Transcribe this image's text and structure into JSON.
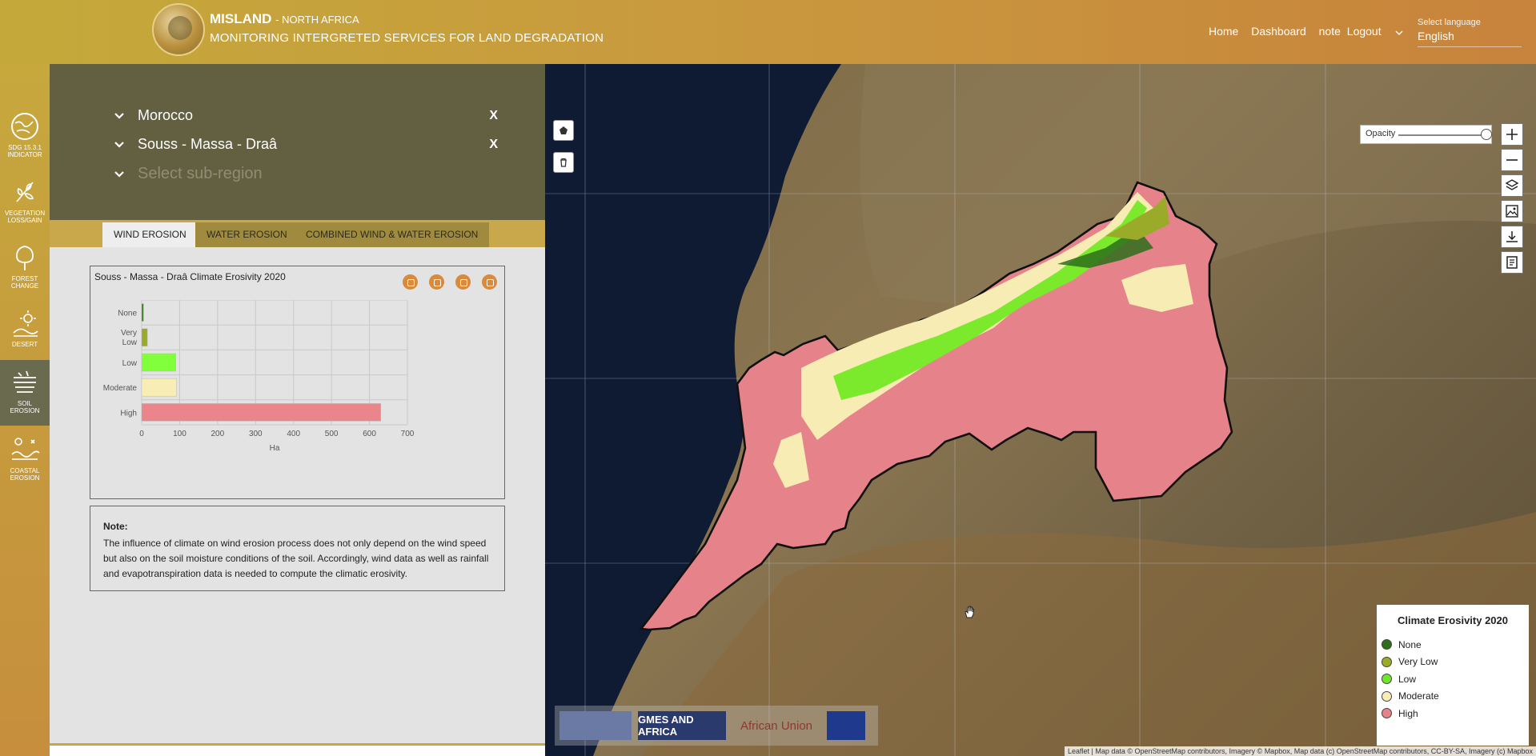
{
  "header": {
    "brand": "MISLAND",
    "brand_suffix": "- NORTH AFRICA",
    "subtitle": "MONITORING INTERGRETED SERVICES FOR LAND DEGRADATION",
    "nav": [
      "Home",
      "Dashboard",
      "note",
      "Logout"
    ],
    "language_label": "Select language",
    "language_value": "English"
  },
  "sidebar": {
    "items": [
      {
        "label_1": "SDG 15.3.1",
        "label_2": "INDICATOR",
        "icon": "globe-icon"
      },
      {
        "label_1": "VEGETATION",
        "label_2": "LOSS/GAIN",
        "icon": "plant-icon"
      },
      {
        "label_1": "FOREST",
        "label_2": "CHANGE",
        "icon": "tree-icon"
      },
      {
        "label_1": "DESERT",
        "label_2": "",
        "icon": "sun-icon"
      },
      {
        "label_1": "SOIL",
        "label_2": "EROSION",
        "icon": "erosion-icon"
      },
      {
        "label_1": "COASTAL",
        "label_2": "EROSION",
        "icon": "coast-icon"
      }
    ],
    "active_index": 4
  },
  "regions": {
    "country": "Morocco",
    "region": "Souss - Massa - Draâ",
    "subregion_placeholder": "Select sub-region",
    "remove_label": "X"
  },
  "tabs": [
    "WIND EROSION",
    "WATER EROSION",
    "COMBINED WIND & WATER EROSION"
  ],
  "chart_panel": {
    "title": "Souss - Massa - Draâ Climate Erosivity 2020",
    "tools": [
      "screenshot-icon",
      "info-icon",
      "refresh-icon",
      "download-icon"
    ]
  },
  "chart_data": {
    "type": "bar",
    "orientation": "horizontal",
    "categories": [
      "None",
      "Very Low",
      "Low",
      "Moderate",
      "High"
    ],
    "values": [
      5,
      15,
      90,
      92,
      630
    ],
    "colors": [
      "#3f7f1f",
      "#9aaa28",
      "#80ff3a",
      "#f8eeb5",
      "#e9858b"
    ],
    "xlabel": "Ha",
    "ylabel": "",
    "xlim": [
      0,
      700
    ],
    "xticks": [
      0,
      100,
      200,
      300,
      400,
      500,
      600,
      700
    ],
    "grid": true
  },
  "note": {
    "heading": "Note:",
    "text": "The influence of climate on wind erosion process does not only depend on the wind speed but also on the soil moisture conditions of the soil. Accordingly, wind data as well as rainfall and evapotranspiration data is needed to compute the climatic erosivity."
  },
  "map": {
    "opacity_label": "Opacity",
    "opacity_value": 1.0,
    "legend_title": "Climate Erosivity 2020",
    "legend": [
      {
        "label": "None",
        "color": "#2e6f1b"
      },
      {
        "label": "Very Low",
        "color": "#9aab2a"
      },
      {
        "label": "Low",
        "color": "#6ee62a"
      },
      {
        "label": "Moderate",
        "color": "#f7ecb3"
      },
      {
        "label": "High",
        "color": "#e6838a"
      }
    ],
    "partners": [
      "GMES AND AFRICA",
      "African Union"
    ],
    "attribution": "Leaflet | Map data © OpenStreetMap contributors, Imagery © Mapbox, Map data (c) OpenStreetMap contributors, CC-BY-SA, Imagery (c) Mapbox"
  }
}
